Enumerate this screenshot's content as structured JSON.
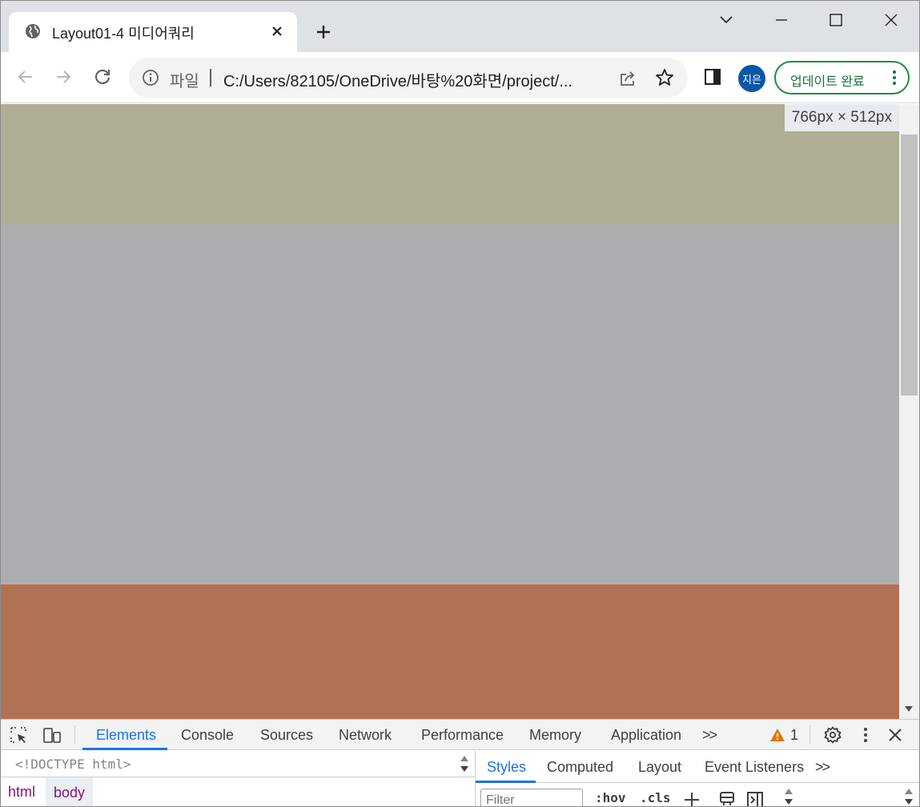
{
  "browser": {
    "tab_title": "Layout01-4 미디어쿼리",
    "scheme_label": "파일",
    "url": "C:/Users/82105/OneDrive/바탕%20화면/project/...",
    "avatar_text": "지은",
    "update_label": "업데이트 완료"
  },
  "viewport": {
    "dimension_badge": "766px × 512px",
    "bands": [
      {
        "name": "header-band",
        "color": "#adae94"
      },
      {
        "name": "main-band",
        "color": "#adacb0"
      },
      {
        "name": "footer-band",
        "color": "#b17254"
      }
    ]
  },
  "devtools": {
    "tabs": [
      "Elements",
      "Console",
      "Sources",
      "Network",
      "Performance",
      "Memory",
      "Application"
    ],
    "active_tab": "Elements",
    "more_tabs": ">>",
    "warning_count": "1",
    "doctype_line": "<!DOCTYPE html>",
    "breadcrumbs": [
      "html",
      "body"
    ],
    "styles_tabs": [
      "Styles",
      "Computed",
      "Layout",
      "Event Listeners"
    ],
    "filter_placeholder": "Filter",
    "hov_label": ":hov",
    "cls_label": ".cls"
  },
  "icons": {
    "favicon": "globe-icon",
    "tab_close": "close-icon",
    "new_tab": "plus-icon",
    "back": "arrow-left-icon",
    "forward": "arrow-right-icon",
    "reload": "reload-icon",
    "site_info": "info-icon",
    "share": "share-icon",
    "bookmark": "star-icon",
    "side_panel": "side-panel-icon",
    "menu": "kebab-icon",
    "inspect": "inspect-element-icon",
    "device": "device-toolbar-icon",
    "warning": "warning-icon",
    "settings": "gear-icon"
  }
}
